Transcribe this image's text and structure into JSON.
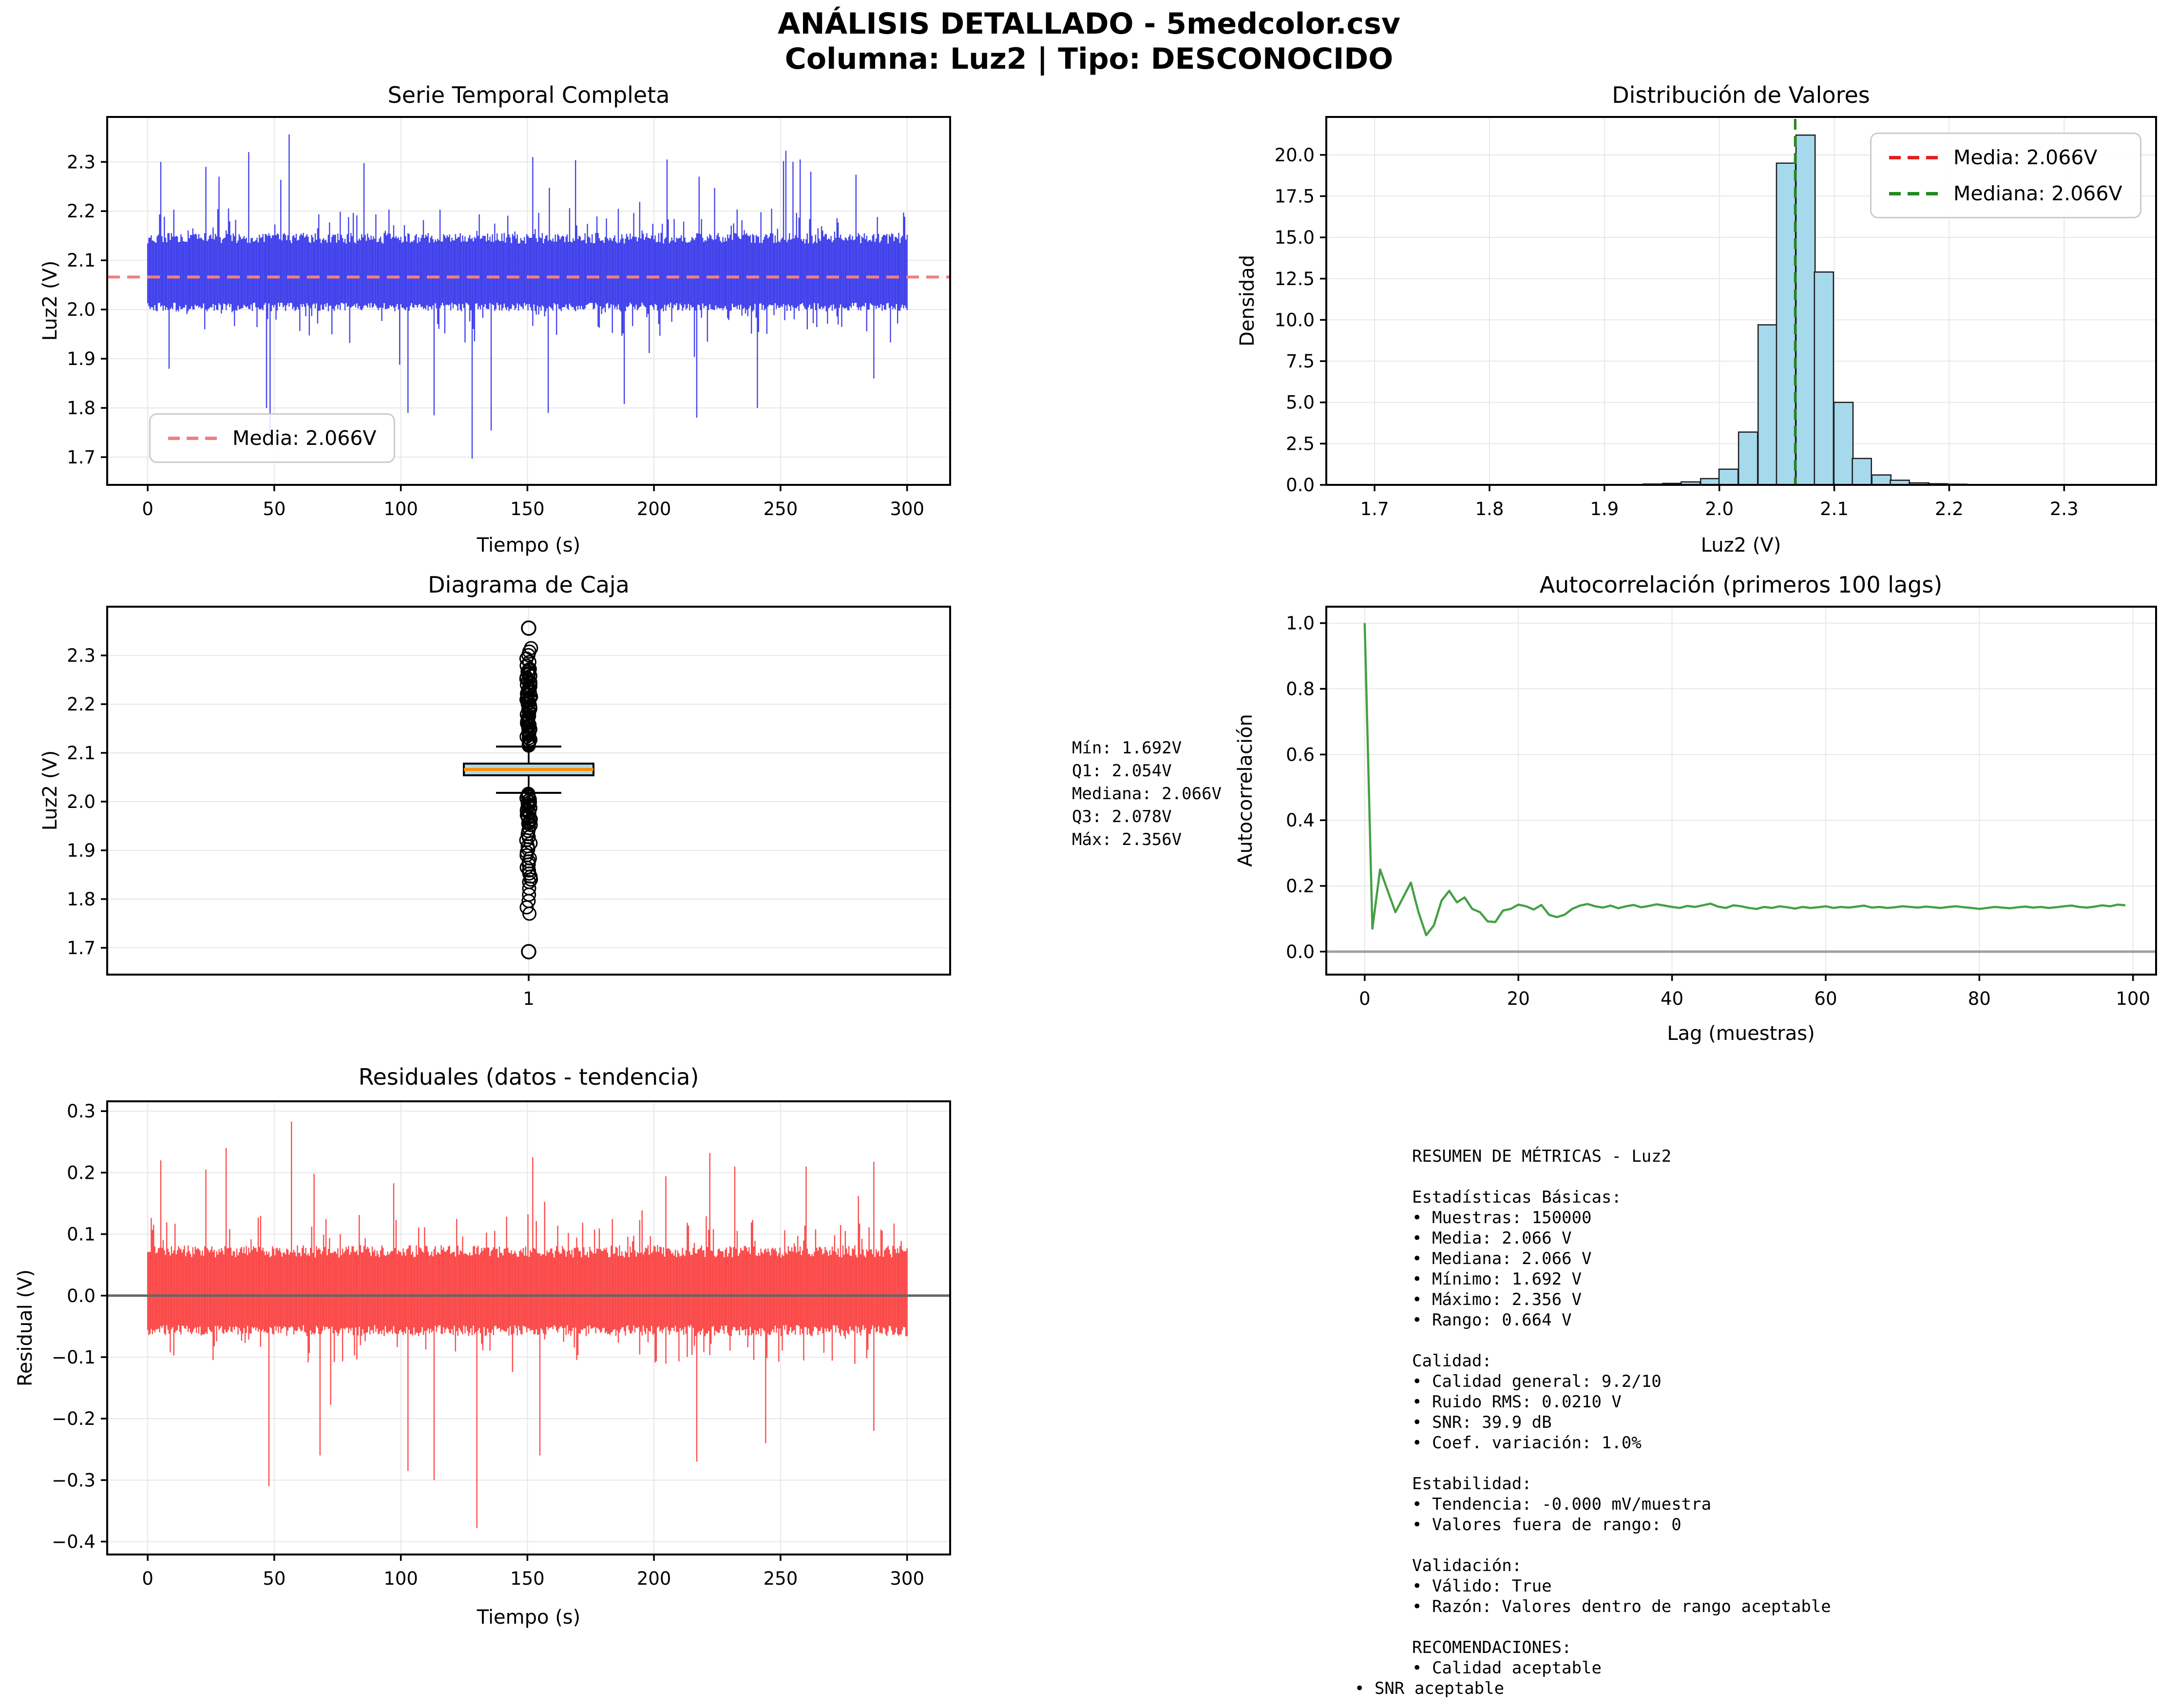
{
  "header": {
    "title_line1": "ANÁLISIS DETALLADO - 5medcolor.csv",
    "title_line2": "Columna: Luz2 | Tipo: DESCONOCIDO"
  },
  "colors": {
    "timeseries_line": "#4343ec",
    "timeseries_mean": "#f08080",
    "hist_bar_fill": "#a6d9ec",
    "hist_bar_edge": "#1c1c1c",
    "hist_mean_line": "#e02020",
    "hist_median_line": "#1f8b1f",
    "box_fill": "#add8e6",
    "box_edge": "#000000",
    "box_median": "#ff8c00",
    "autocorr_line": "#44a044",
    "residual_line": "#fb4b4b",
    "zero_line_gray": "#9e9e9e",
    "zero_line_dark": "#666666",
    "grid": "#e7e7e7",
    "spine": "#000000"
  },
  "chart_data": [
    {
      "id": "serie",
      "type": "noise-band",
      "title": "Serie Temporal Completa",
      "xlabel": "Tiempo (s)",
      "ylabel": "Luz2 (V)",
      "xlim": [
        -16,
        317
      ],
      "ylim": [
        1.6436,
        2.3914
      ],
      "xticks": [
        0,
        50,
        100,
        150,
        200,
        250,
        300
      ],
      "xtick_labels": [
        "0",
        "50",
        "100",
        "150",
        "200",
        "250",
        "300"
      ],
      "yticks": [
        1.7,
        1.8,
        1.9,
        2.0,
        2.1,
        2.2,
        2.3
      ],
      "ytick_labels": [
        "1.7",
        "1.8",
        "1.9",
        "2.0",
        "2.1",
        "2.2",
        "2.3"
      ],
      "mean": 2.066,
      "legend_label": "Media: 2.066V",
      "noise": {
        "seed": 7,
        "columns": 640,
        "x_start": 0,
        "x_end": 300,
        "base": 2.066,
        "top_base": 0.068,
        "top_jitter": 0.022,
        "bot_base": 0.052,
        "bot_jitter": 0.018,
        "p_up": 0.1,
        "up_min": 0.085,
        "up_max": 0.14,
        "p_up_big": 0.02,
        "upb_min": 0.13,
        "upb_max": 0.27,
        "p_dn": 0.09,
        "dn_min": 0.07,
        "dn_max": 0.12,
        "p_dn_big": 0.018,
        "dnb_min": 0.11,
        "dnb_max": 0.33
      },
      "forced": [
        {
          "x": 56,
          "top": 2.356
        },
        {
          "x": 40,
          "top": 2.32
        },
        {
          "x": 5,
          "top": 2.3
        },
        {
          "x": 23,
          "top": 2.29
        },
        {
          "x": 28,
          "top": 2.27
        },
        {
          "x": 152,
          "top": 2.31
        },
        {
          "x": 205,
          "top": 2.305
        },
        {
          "x": 255,
          "top": 2.3
        },
        {
          "x": 262,
          "top": 2.28
        },
        {
          "x": 218,
          "top": 2.27
        },
        {
          "x": 128,
          "bottom": 1.697
        },
        {
          "x": 47,
          "bottom": 1.8
        },
        {
          "x": 103,
          "bottom": 1.79
        },
        {
          "x": 113,
          "bottom": 1.785
        },
        {
          "x": 217,
          "bottom": 1.78
        },
        {
          "x": 158,
          "bottom": 1.79
        },
        {
          "x": 241,
          "bottom": 1.8
        },
        {
          "x": 287,
          "bottom": 1.86
        }
      ]
    },
    {
      "id": "hist",
      "type": "histogram",
      "title": "Distribución de Valores",
      "xlabel": "Luz2 (V)",
      "ylabel": "Densidad",
      "xlim": [
        1.658,
        2.38
      ],
      "ylim": [
        0,
        22.3
      ],
      "xticks": [
        1.7,
        1.8,
        1.9,
        2.0,
        2.1,
        2.2,
        2.3
      ],
      "xtick_labels": [
        "1.7",
        "1.8",
        "1.9",
        "2.0",
        "2.1",
        "2.2",
        "2.3"
      ],
      "yticks": [
        0.0,
        2.5,
        5.0,
        7.5,
        10.0,
        12.5,
        15.0,
        17.5,
        20.0
      ],
      "ytick_labels": [
        "0.0",
        "2.5",
        "5.0",
        "7.5",
        "10.0",
        "12.5",
        "15.0",
        "17.5",
        "20.0"
      ],
      "bin_width": 0.01657,
      "bars": [
        {
          "x": 1.942,
          "h": 0.05
        },
        {
          "x": 1.959,
          "h": 0.09
        },
        {
          "x": 1.975,
          "h": 0.18
        },
        {
          "x": 1.992,
          "h": 0.38
        },
        {
          "x": 2.008,
          "h": 0.95
        },
        {
          "x": 2.025,
          "h": 3.2
        },
        {
          "x": 2.042,
          "h": 9.7
        },
        {
          "x": 2.058,
          "h": 19.5
        },
        {
          "x": 2.075,
          "h": 21.2
        },
        {
          "x": 2.091,
          "h": 12.9
        },
        {
          "x": 2.108,
          "h": 5.0
        },
        {
          "x": 2.124,
          "h": 1.6
        },
        {
          "x": 2.141,
          "h": 0.6
        },
        {
          "x": 2.157,
          "h": 0.28
        },
        {
          "x": 2.174,
          "h": 0.12
        },
        {
          "x": 2.19,
          "h": 0.07
        },
        {
          "x": 2.207,
          "h": 0.04
        },
        {
          "x": 2.223,
          "h": 0.02
        }
      ],
      "mean": 2.066,
      "median": 2.066,
      "legend_mean_label": "Media: 2.066V",
      "legend_median_label": "Mediana: 2.066V"
    },
    {
      "id": "caja",
      "type": "boxplot",
      "title": "Diagrama de Caja",
      "ylabel": "Luz2 (V)",
      "xlim": [
        0.5,
        1.5
      ],
      "ylim": [
        1.645,
        2.4
      ],
      "xticks": [
        1
      ],
      "xtick_labels": [
        "1"
      ],
      "yticks": [
        1.7,
        1.8,
        1.9,
        2.0,
        2.1,
        2.2,
        2.3
      ],
      "ytick_labels": [
        "1.7",
        "1.8",
        "1.9",
        "2.0",
        "2.1",
        "2.2",
        "2.3"
      ],
      "box": {
        "q1": 2.054,
        "median": 2.066,
        "q3": 2.078,
        "whisker_low": 2.018,
        "whisker_high": 2.113,
        "min": 1.692,
        "max": 2.356,
        "outliers_above": {
          "dense_from": 2.115,
          "dense_to": 2.27,
          "dense_n": 52,
          "sparse_from": 2.272,
          "sparse_to": 2.315,
          "sparse_n": 7,
          "extreme": 2.356
        },
        "outliers_below": {
          "dense_from": 2.016,
          "dense_to": 1.955,
          "dense_n": 22,
          "mid_from": 1.952,
          "mid_to": 1.84,
          "mid_n": 19,
          "sparse_from": 1.835,
          "sparse_to": 1.77,
          "sparse_n": 6,
          "extreme": 1.692
        },
        "seed": 11
      }
    },
    {
      "id": "autocorr",
      "type": "line",
      "title": "Autocorrelación (primeros 100 lags)",
      "xlabel": "Lag (muestras)",
      "ylabel": "Autocorrelación",
      "xlim": [
        -5,
        103
      ],
      "ylim": [
        -0.07,
        1.05
      ],
      "xticks": [
        0,
        20,
        40,
        60,
        80,
        100
      ],
      "xtick_labels": [
        "0",
        "20",
        "40",
        "60",
        "80",
        "100"
      ],
      "yticks": [
        0.0,
        0.2,
        0.4,
        0.6,
        0.8,
        1.0
      ],
      "ytick_labels": [
        "0.0",
        "0.2",
        "0.4",
        "0.6",
        "0.8",
        "1.0"
      ],
      "zero_line": true,
      "values": [
        1.0,
        0.07,
        0.25,
        0.185,
        0.12,
        0.165,
        0.21,
        0.12,
        0.05,
        0.08,
        0.155,
        0.185,
        0.15,
        0.165,
        0.13,
        0.12,
        0.092,
        0.09,
        0.125,
        0.13,
        0.143,
        0.138,
        0.128,
        0.142,
        0.112,
        0.105,
        0.112,
        0.13,
        0.14,
        0.145,
        0.138,
        0.134,
        0.14,
        0.132,
        0.138,
        0.142,
        0.135,
        0.139,
        0.144,
        0.14,
        0.136,
        0.133,
        0.139,
        0.136,
        0.141,
        0.146,
        0.137,
        0.133,
        0.141,
        0.138,
        0.133,
        0.13,
        0.136,
        0.133,
        0.138,
        0.135,
        0.131,
        0.136,
        0.133,
        0.135,
        0.138,
        0.133,
        0.136,
        0.134,
        0.137,
        0.14,
        0.134,
        0.136,
        0.133,
        0.135,
        0.138,
        0.136,
        0.134,
        0.137,
        0.135,
        0.133,
        0.136,
        0.138,
        0.135,
        0.133,
        0.13,
        0.133,
        0.136,
        0.134,
        0.132,
        0.135,
        0.137,
        0.134,
        0.136,
        0.133,
        0.135,
        0.138,
        0.14,
        0.136,
        0.134,
        0.137,
        0.141,
        0.138,
        0.143,
        0.141
      ]
    },
    {
      "id": "resid",
      "type": "noise-band",
      "title": "Residuales (datos - tendencia)",
      "xlabel": "Tiempo (s)",
      "ylabel": "Residual (V)",
      "xlim": [
        -16,
        317
      ],
      "ylim": [
        -0.421,
        0.316
      ],
      "xticks": [
        0,
        50,
        100,
        150,
        200,
        250,
        300
      ],
      "xtick_labels": [
        "0",
        "50",
        "100",
        "150",
        "200",
        "250",
        "300"
      ],
      "yticks": [
        0.3,
        0.2,
        0.1,
        0.0,
        -0.1,
        -0.2,
        -0.3,
        -0.4
      ],
      "ytick_labels": [
        "0.3",
        "0.2",
        "0.1",
        "0.0",
        "−0.1",
        "−0.2",
        "−0.3",
        "−0.4"
      ],
      "zero_line": true,
      "noise": {
        "seed": 21,
        "columns": 640,
        "x_start": 0,
        "x_end": 300,
        "base": 0,
        "top_base": 0.062,
        "top_jitter": 0.02,
        "bot_base": 0.048,
        "bot_jitter": 0.018,
        "p_up": 0.1,
        "up_min": 0.085,
        "up_max": 0.13,
        "p_up_big": 0.016,
        "upb_min": 0.13,
        "upb_max": 0.23,
        "p_dn": 0.09,
        "dn_min": 0.07,
        "dn_max": 0.11,
        "p_dn_big": 0.015,
        "dnb_min": 0.11,
        "dnb_max": 0.26
      },
      "forced": [
        {
          "x": 57,
          "top": 0.283
        },
        {
          "x": 31,
          "top": 0.24
        },
        {
          "x": 152,
          "top": 0.225
        },
        {
          "x": 222,
          "top": 0.232
        },
        {
          "x": 232,
          "top": 0.21
        },
        {
          "x": 260,
          "top": 0.21
        },
        {
          "x": 5,
          "top": 0.22
        },
        {
          "x": 23,
          "top": 0.205
        },
        {
          "x": 130,
          "bottom": -0.378
        },
        {
          "x": 48,
          "bottom": -0.31
        },
        {
          "x": 103,
          "bottom": -0.285
        },
        {
          "x": 113,
          "bottom": -0.3
        },
        {
          "x": 68,
          "bottom": -0.26
        },
        {
          "x": 155,
          "bottom": -0.26
        },
        {
          "x": 217,
          "bottom": -0.27
        },
        {
          "x": 244,
          "bottom": -0.24
        },
        {
          "x": 287,
          "bottom": -0.22
        }
      ]
    }
  ],
  "stats_panel": {
    "lines": [
      "Mín: 1.692V",
      "Q1: 2.054V",
      "Mediana: 2.066V",
      "Q3: 2.078V",
      "Máx: 2.356V"
    ]
  },
  "metrics_panel": {
    "lines": [
      "RESUMEN DE MÉTRICAS - Luz2",
      "",
      "Estadísticas Básicas:",
      "• Muestras: 150000",
      "• Media: 2.066 V",
      "• Mediana: 2.066 V",
      "• Mínimo: 1.692 V",
      "• Máximo: 2.356 V",
      "• Rango: 0.664 V",
      "",
      "Calidad:",
      "• Calidad general: 9.2/10",
      "• Ruido RMS: 0.0210 V",
      "• SNR: 39.9 dB",
      "• Coef. variación: 1.0%",
      "",
      "Estabilidad:",
      "• Tendencia: -0.000 mV/muestra",
      "• Valores fuera de rango: 0",
      "",
      "Validación:",
      "• Válido: True",
      "• Razón: Valores dentro de rango aceptable",
      "",
      "RECOMENDACIONES:",
      "• Calidad aceptable"
    ],
    "footer": "• SNR aceptable"
  }
}
